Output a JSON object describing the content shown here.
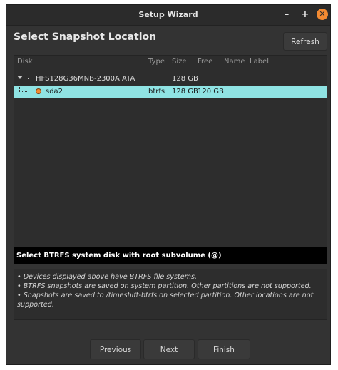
{
  "window": {
    "title": "Setup Wizard"
  },
  "page": {
    "heading": "Select Snapshot Location",
    "refresh_label": "Refresh"
  },
  "table": {
    "columns": [
      "Disk",
      "Type",
      "Size",
      "Free",
      "Name",
      "Label"
    ],
    "disk": {
      "name": "HFS128G36MNB-2300A ATA",
      "size": "128 GB"
    },
    "partition": {
      "name": "sda2",
      "type": "btrfs",
      "size": "128 GB",
      "free": "120 GB"
    }
  },
  "status_text": "Select BTRFS system disk with root subvolume (@)",
  "notes": [
    "• Devices displayed above have BTRFS file systems.",
    "• BTRFS snapshots are saved on system partition. Other partitions are not supported.",
    "• Snapshots are saved to /timeshift-btrfs on selected partition. Other locations are not supported."
  ],
  "footer": {
    "previous_label": "Previous",
    "next_label": "Next",
    "finish_label": "Finish"
  },
  "colors": {
    "selection": "#8fe3e3",
    "accent": "#f28a32",
    "window_bg": "#333333"
  }
}
